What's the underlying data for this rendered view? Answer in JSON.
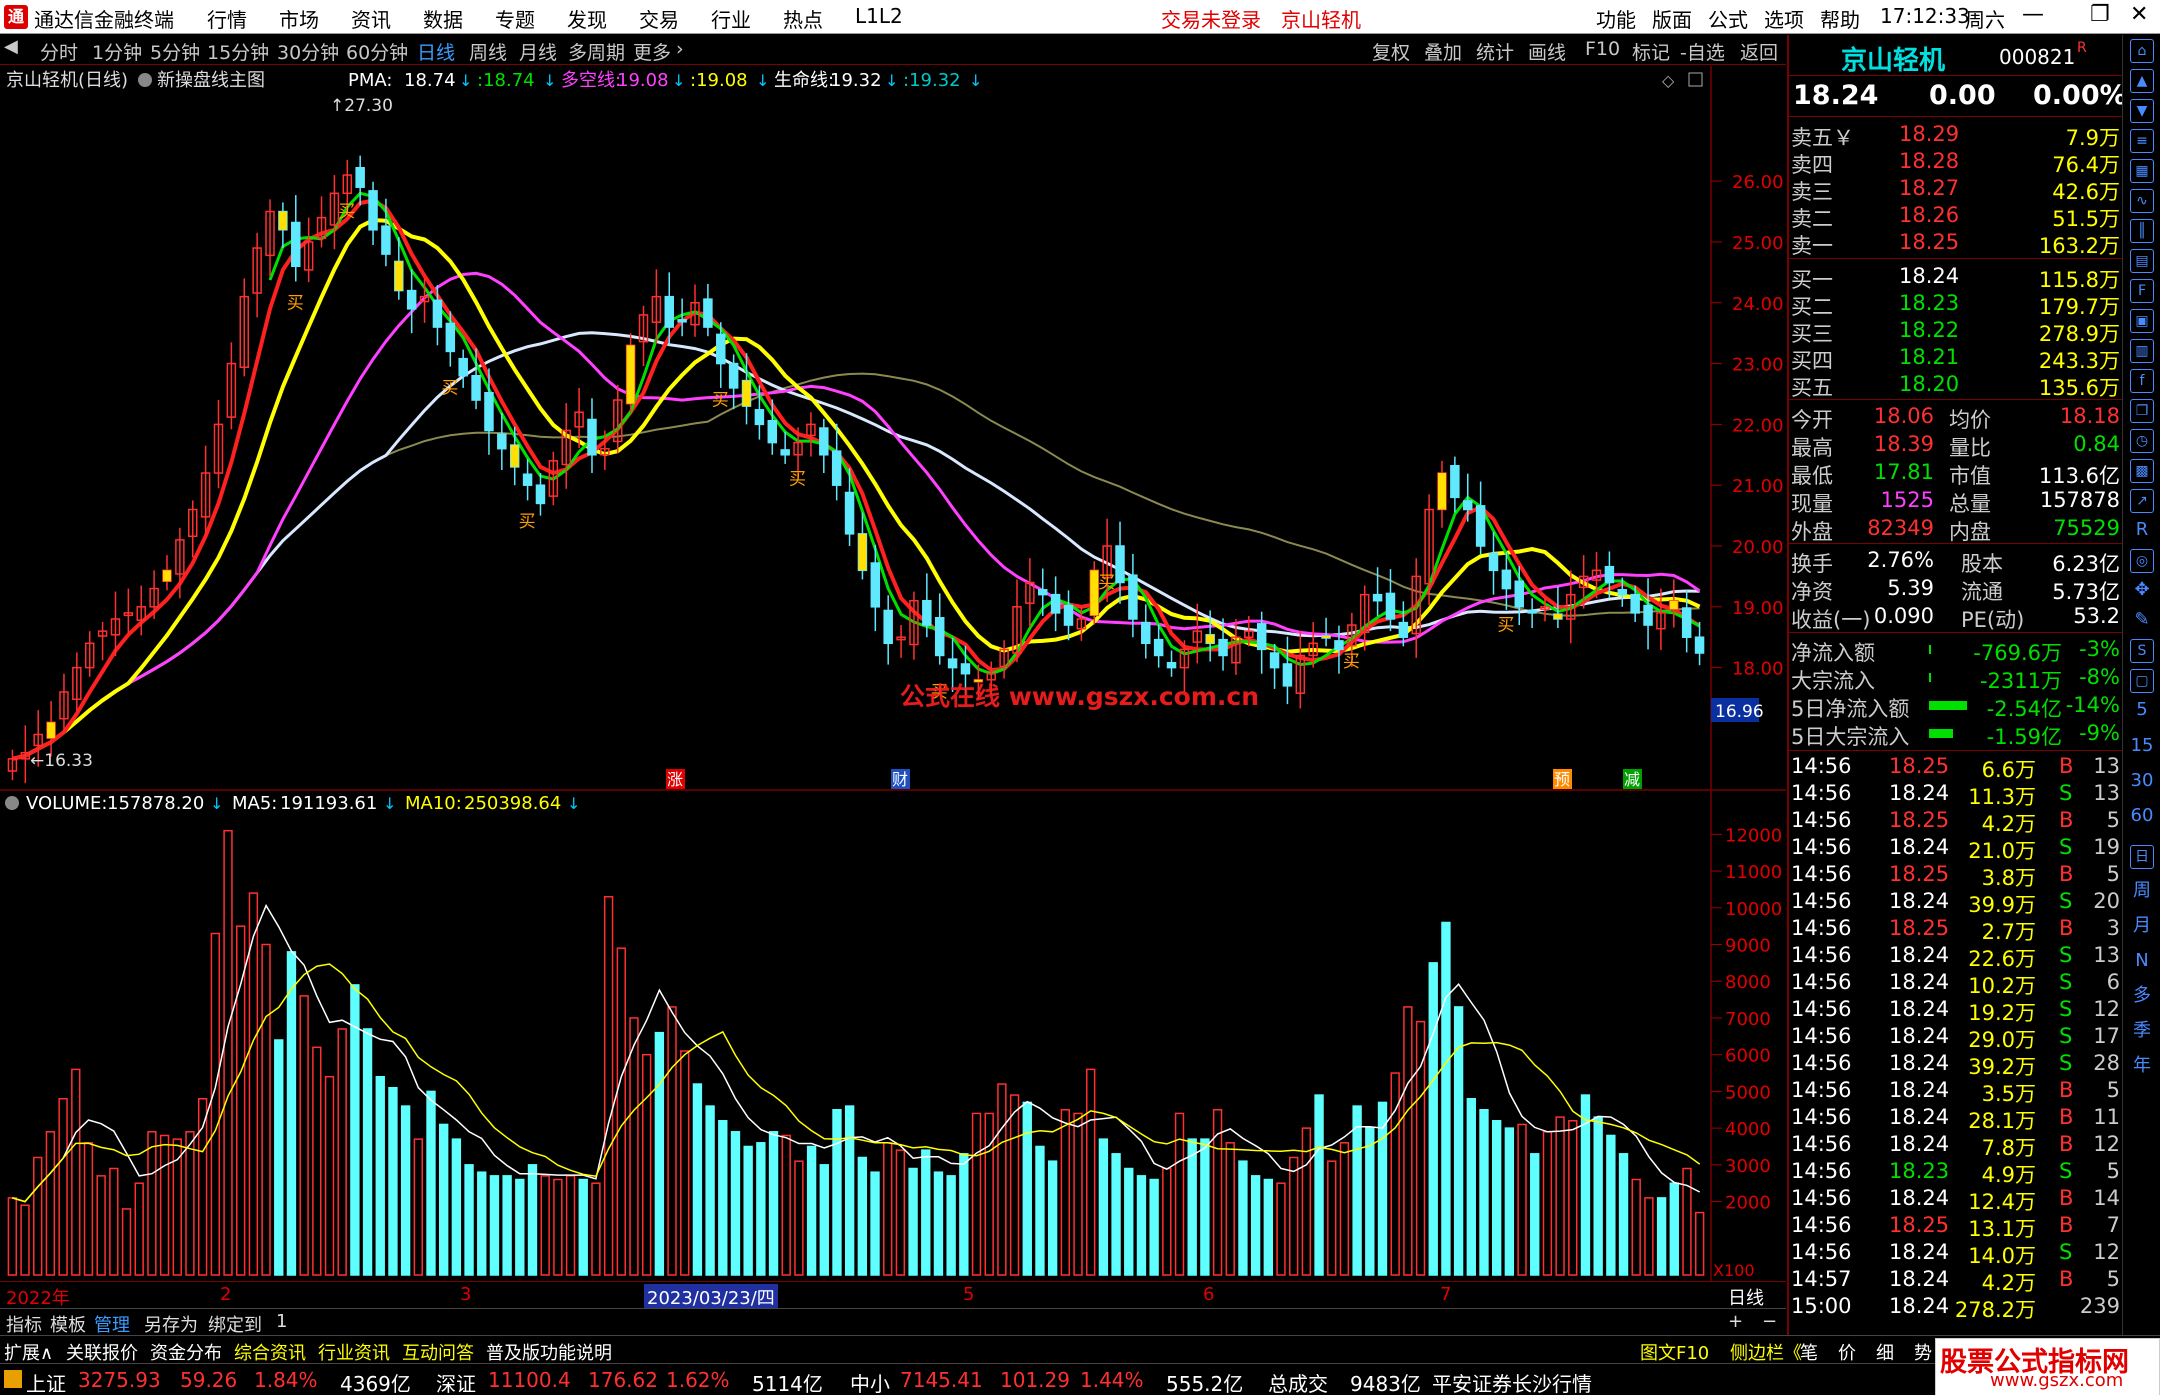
{
  "app": {
    "title": "通达信金融终端",
    "login_status": "交易未登录",
    "stock_title": "京山轻机",
    "menus": [
      "行情",
      "市场",
      "资讯",
      "数据",
      "专题",
      "发现",
      "交易",
      "行业",
      "热点",
      "L1L2"
    ],
    "right_menus": [
      "功能",
      "版面",
      "公式",
      "选项",
      "帮助"
    ],
    "time": "17:12:33",
    "weekday": "周六"
  },
  "toolbar": {
    "periods": [
      "分时",
      "1分钟",
      "5分钟",
      "15分钟",
      "30分钟",
      "60分钟",
      "日线",
      "周线",
      "月线",
      "多周期",
      "更多"
    ],
    "active_period": "日线",
    "buttons": [
      "复权",
      "叠加",
      "统计",
      "画线",
      "F10",
      "标记",
      "-自选",
      "返回"
    ]
  },
  "main_chart": {
    "caption": "京山轻机(日线)",
    "formula": "新操盘线主图",
    "indicators": [
      {
        "label": "PMA:",
        "value": "18.74",
        "color": "#ffffff"
      },
      {
        "label": "",
        "value": ":18.74",
        "color": "#00e000"
      },
      {
        "label": "多空线:",
        "value": "19.08",
        "color": "#ff40ff"
      },
      {
        "label": "",
        "value": ":19.08",
        "color": "#ffff00"
      },
      {
        "label": "生命线:",
        "value": "19.32",
        "color": "#ffffff"
      },
      {
        "label": "",
        "value": ":19.32",
        "color": "#00c8c8"
      }
    ],
    "watermark": "公式在线   www.gszx.com.cn",
    "max_label": "27.30",
    "min_label": "16.33",
    "right_tag": "16.96",
    "events": [
      "涨",
      "财",
      "预",
      "减"
    ]
  },
  "vol_chart": {
    "indicators": [
      {
        "label": "VOLUME:",
        "value": "157878.20",
        "color": "#ffffff"
      },
      {
        "label": "MA5:",
        "value": "191193.61",
        "color": "#ffffff"
      },
      {
        "label": "MA10:",
        "value": "250398.64",
        "color": "#ffff00"
      }
    ],
    "unit": "X100"
  },
  "chart_data": [
    {
      "type": "candlestick",
      "title": "京山轻机(日线)",
      "yticks": [
        18.0,
        19.0,
        20.0,
        21.0,
        22.0,
        23.0,
        24.0,
        25.0,
        26.0
      ],
      "ylim": [
        16.3,
        27.4
      ],
      "close": [
        16.5,
        16.6,
        16.9,
        17.1,
        17.6,
        18.0,
        18.4,
        18.6,
        18.8,
        18.9,
        19.0,
        19.3,
        19.6,
        20.1,
        20.6,
        21.2,
        22.0,
        23.0,
        24.1,
        24.9,
        25.5,
        25.2,
        24.6,
        25.0,
        25.4,
        25.8,
        26.1,
        25.9,
        25.2,
        24.8,
        24.2,
        23.9,
        24.1,
        23.6,
        23.2,
        22.8,
        22.4,
        21.9,
        21.6,
        21.3,
        21.0,
        20.7,
        21.4,
        21.9,
        22.2,
        21.5,
        21.6,
        22.4,
        23.3,
        23.8,
        24.1,
        23.6,
        23.7,
        24.0,
        23.6,
        23.0,
        22.6,
        22.3,
        22.0,
        21.7,
        21.5,
        21.7,
        22.0,
        21.5,
        21.0,
        20.2,
        19.6,
        19.0,
        18.4,
        18.5,
        19.1,
        18.7,
        18.2,
        18.0,
        17.9,
        17.8,
        17.9,
        18.3,
        19.0,
        19.4,
        19.2,
        18.9,
        18.7,
        18.8,
        19.6,
        20.0,
        19.4,
        18.8,
        18.4,
        18.2,
        18.0,
        18.3,
        18.6,
        18.4,
        18.2,
        18.5,
        18.6,
        18.3,
        18.0,
        17.7,
        18.2,
        18.4,
        18.5,
        18.3,
        18.7,
        19.2,
        19.1,
        18.8,
        18.5,
        19.5,
        20.6,
        21.2,
        20.8,
        20.6,
        20.0,
        19.6,
        19.3,
        19.0,
        18.9,
        19.0,
        18.8,
        19.2,
        19.5,
        19.6,
        19.4,
        19.2,
        18.9,
        18.7,
        18.9,
        19.1,
        18.5,
        18.24
      ],
      "buy_signals": [
        "买",
        "买",
        "买",
        "买",
        "买",
        "买",
        "买",
        "买",
        "买",
        "买"
      ]
    },
    {
      "type": "bar",
      "title": "VOLUME",
      "yticks": [
        2000,
        3000,
        4000,
        5000,
        6000,
        7000,
        8000,
        9000,
        10000,
        11000,
        12000
      ],
      "ylim": [
        0,
        12500
      ],
      "values": [
        2100,
        1900,
        3200,
        3900,
        4800,
        5600,
        3600,
        2700,
        2900,
        1800,
        2500,
        3900,
        3800,
        3700,
        3900,
        4800,
        9300,
        12100,
        9500,
        10400,
        9000,
        6400,
        8800,
        7600,
        6200,
        5400,
        6700,
        7900,
        6700,
        5400,
        5100,
        4600,
        3700,
        5000,
        4100,
        3700,
        3000,
        2800,
        2700,
        2700,
        2600,
        3000,
        2700,
        2600,
        2700,
        2600,
        2500,
        10300,
        8900,
        7000,
        6000,
        6600,
        7300,
        6100,
        5200,
        4600,
        4200,
        3900,
        3500,
        3600,
        3900,
        3800,
        3100,
        3500,
        3000,
        4500,
        4600,
        3200,
        2800,
        3600,
        3400,
        2900,
        3400,
        2800,
        2700,
        3300,
        4400,
        4400,
        5200,
        4900,
        4700,
        3500,
        3100,
        4500,
        4400,
        5600,
        3700,
        3300,
        2900,
        2700,
        2600,
        2900,
        4400,
        3700,
        3700,
        4500,
        3600,
        3100,
        2700,
        2600,
        2500,
        3200,
        4000,
        4900,
        3100,
        3600,
        4600,
        4000,
        4700,
        5500,
        7300,
        6900,
        8500,
        9600,
        7300,
        4800,
        4500,
        4200,
        4000,
        4100,
        3300,
        3900,
        4300,
        4200,
        4900,
        4300,
        3800,
        3300,
        2600,
        2100,
        2100,
        2500,
        2900,
        1700
      ]
    }
  ],
  "date_axis": [
    "2022年",
    "2",
    "3",
    "2023/03/23/四",
    "5",
    "6",
    "7",
    "日线"
  ],
  "bottom_tabs": [
    "指标",
    "模板",
    "管理",
    "另存为",
    "绑定到",
    "1"
  ],
  "info_tabs": [
    "扩展∧",
    "关联报价",
    "资金分布",
    "综合资讯",
    "行业资讯",
    "互动问答",
    "普及版功能说明"
  ],
  "info_right": [
    "图文F10",
    "侧边栏《",
    "笔",
    "价",
    "细",
    "势"
  ],
  "quote": {
    "name": "京山轻机",
    "code": "000821",
    "mark": "R",
    "price": "18.24",
    "change": "0.00",
    "pct": "0.00%",
    "asks": [
      {
        "label": "卖五￥",
        "price": "18.29",
        "vol": "7.9万"
      },
      {
        "label": "卖四",
        "price": "18.28",
        "vol": "76.4万"
      },
      {
        "label": "卖三",
        "price": "18.27",
        "vol": "42.6万"
      },
      {
        "label": "卖二",
        "price": "18.26",
        "vol": "51.5万"
      },
      {
        "label": "卖一",
        "price": "18.25",
        "vol": "163.2万"
      }
    ],
    "bids": [
      {
        "label": "买一",
        "price": "18.24",
        "vol": "115.8万"
      },
      {
        "label": "买二",
        "price": "18.23",
        "vol": "179.7万"
      },
      {
        "label": "买三",
        "price": "18.22",
        "vol": "278.9万"
      },
      {
        "label": "买四",
        "price": "18.21",
        "vol": "243.3万"
      },
      {
        "label": "买五",
        "price": "18.20",
        "vol": "135.6万"
      }
    ],
    "stats": [
      {
        "l1": "今开",
        "v1": "18.06",
        "c1": "#ff3030",
        "l2": "均价",
        "v2": "18.18",
        "c2": "#ff3030"
      },
      {
        "l1": "最高",
        "v1": "18.39",
        "c1": "#ff3030",
        "l2": "量比",
        "v2": "0.84",
        "c2": "#00e000"
      },
      {
        "l1": "最低",
        "v1": "17.81",
        "c1": "#00e000",
        "l2": "市值",
        "v2": "113.6亿",
        "c2": "#ffffff"
      },
      {
        "l1": "现量",
        "v1": "1525",
        "c1": "#ff40ff",
        "l2": "总量",
        "v2": "157878",
        "c2": "#ffffff"
      },
      {
        "l1": "外盘",
        "v1": "82349",
        "c1": "#ff3030",
        "l2": "内盘",
        "v2": "75529",
        "c2": "#00e000"
      }
    ],
    "fund": [
      {
        "l1": "换手",
        "v1": "2.76%",
        "l2": "股本",
        "v2": "6.23亿"
      },
      {
        "l1": "净资",
        "v1": "5.39",
        "l2": "流通",
        "v2": "5.73亿"
      },
      {
        "l1": "收益(一)",
        "v1": "0.090",
        "l2": "PE(动)",
        "v2": "53.2"
      }
    ],
    "flow": [
      {
        "label": "净流入额",
        "value": "-769.6万",
        "pct": "-3%",
        "bar": 0.02
      },
      {
        "label": "大宗流入",
        "value": "-2311万",
        "pct": "-8%",
        "bar": 0.02
      },
      {
        "label": "5日净流入额",
        "value": "-2.54亿",
        "pct": "-14%",
        "bar": 0.95
      },
      {
        "label": "5日大宗流入",
        "value": "-1.59亿",
        "pct": "-9%",
        "bar": 0.6
      }
    ],
    "ticks": [
      [
        "14:56",
        "18.25",
        "6.6万",
        "B",
        "13"
      ],
      [
        "14:56",
        "18.24",
        "11.3万",
        "S",
        "13"
      ],
      [
        "14:56",
        "18.25",
        "4.2万",
        "B",
        "5"
      ],
      [
        "14:56",
        "18.24",
        "21.0万",
        "S",
        "19"
      ],
      [
        "14:56",
        "18.25",
        "3.8万",
        "B",
        "5"
      ],
      [
        "14:56",
        "18.24",
        "39.9万",
        "S",
        "20"
      ],
      [
        "14:56",
        "18.25",
        "2.7万",
        "B",
        "3"
      ],
      [
        "14:56",
        "18.24",
        "22.6万",
        "S",
        "13"
      ],
      [
        "14:56",
        "18.24",
        "10.2万",
        "S",
        "6"
      ],
      [
        "14:56",
        "18.24",
        "19.2万",
        "S",
        "12"
      ],
      [
        "14:56",
        "18.24",
        "29.0万",
        "S",
        "17"
      ],
      [
        "14:56",
        "18.24",
        "39.2万",
        "S",
        "28"
      ],
      [
        "14:56",
        "18.24",
        "3.5万",
        "B",
        "5"
      ],
      [
        "14:56",
        "18.24",
        "28.1万",
        "B",
        "11"
      ],
      [
        "14:56",
        "18.24",
        "7.8万",
        "B",
        "12"
      ],
      [
        "14:56",
        "18.23",
        "4.9万",
        "S",
        "5"
      ],
      [
        "14:56",
        "18.24",
        "12.4万",
        "B",
        "14"
      ],
      [
        "14:56",
        "18.25",
        "13.1万",
        "B",
        "7"
      ],
      [
        "14:56",
        "18.24",
        "14.0万",
        "S",
        "12"
      ],
      [
        "14:57",
        "18.24",
        "4.2万",
        "B",
        "5"
      ],
      [
        "15:00",
        "18.24",
        "278.2万",
        "",
        "239"
      ]
    ]
  },
  "side_icons": [
    "日",
    "周",
    "月",
    "N",
    "多",
    "季",
    "年"
  ],
  "status": {
    "sh_label": "上证",
    "sh": "3275.93",
    "sh_chg": "59.26",
    "sh_pct": "1.84%",
    "sh_amt": "4369亿",
    "sz_label": "深证",
    "sz": "11100.4",
    "sz_chg": "176.62",
    "sz_pct": "1.62%",
    "sz_amt": "5114亿",
    "zx_label": "中小",
    "zx": "7145.41",
    "zx_chg": "101.29",
    "zx_pct": "1.44%",
    "zx_amt": "555.2亿",
    "total_label": "总成交",
    "total": "9483亿",
    "broker": "平安证券长沙行情",
    "brand": "股票公式指标网",
    "brand_url": "www.gszx.com"
  }
}
